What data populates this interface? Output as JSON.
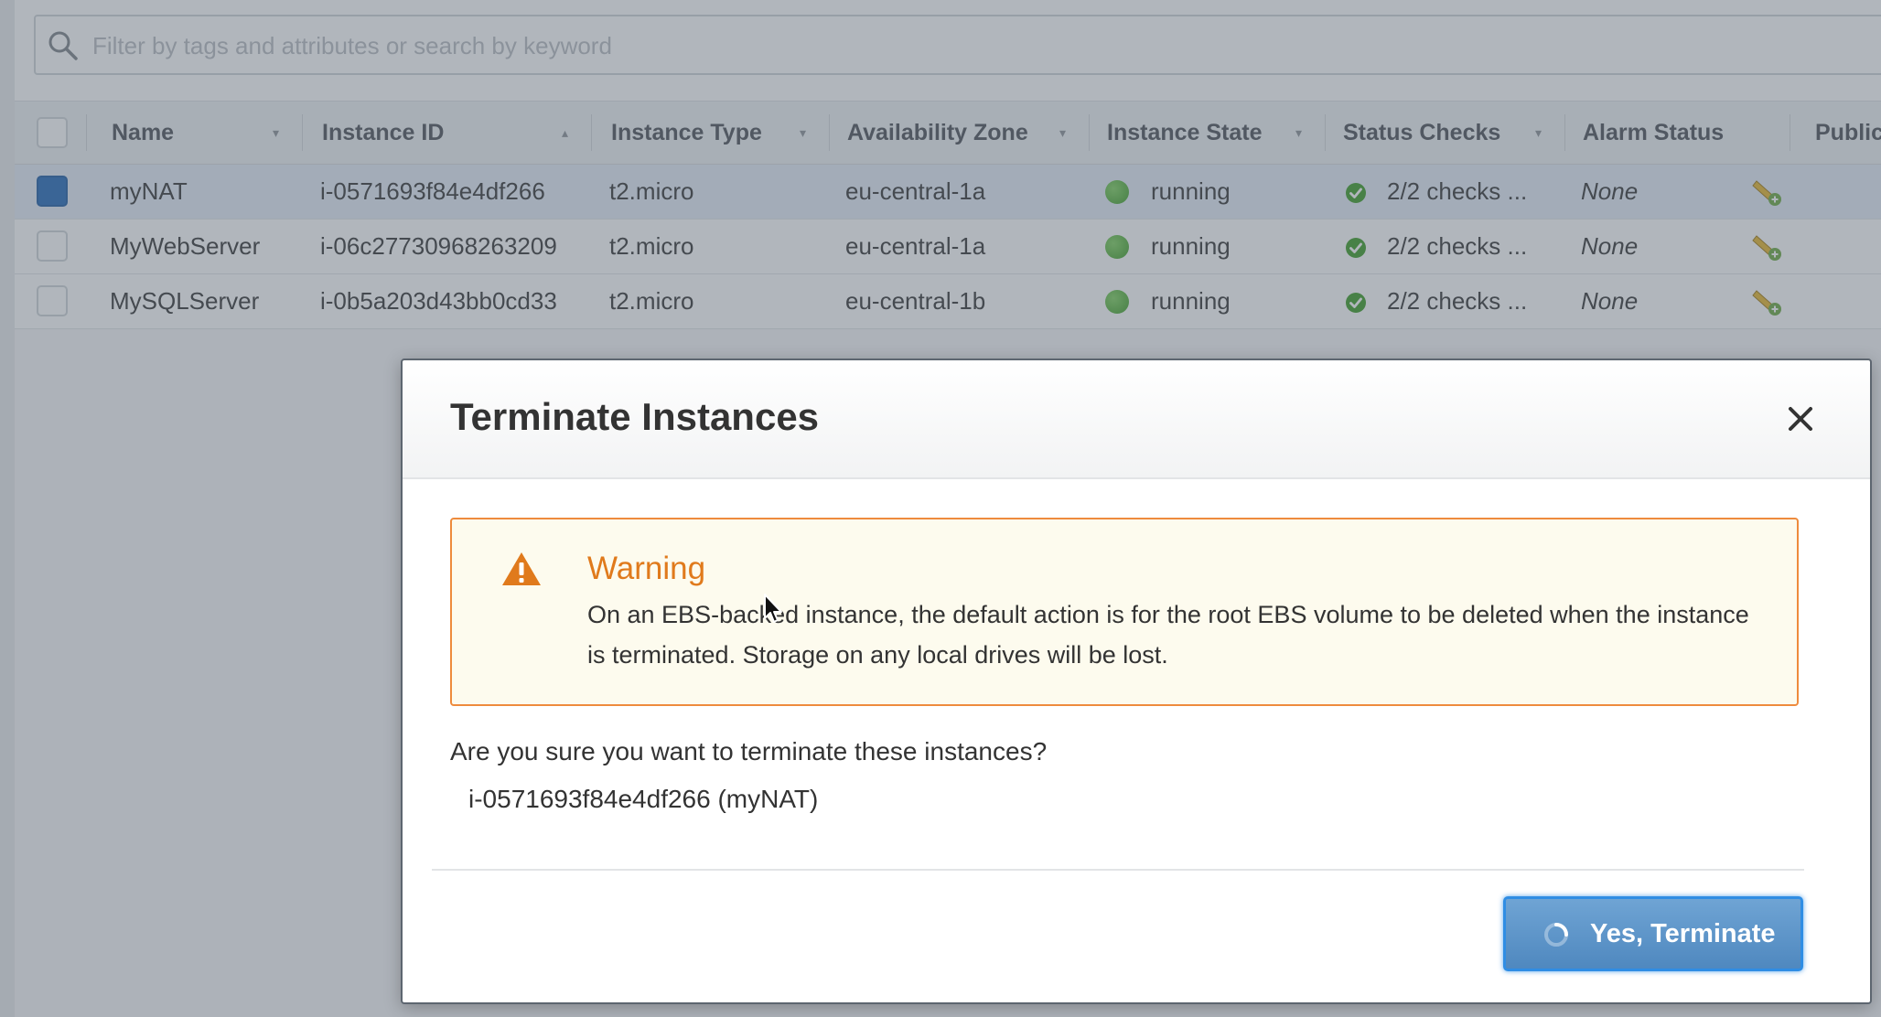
{
  "search": {
    "placeholder": "Filter by tags and attributes or search by keyword"
  },
  "table": {
    "columns": [
      {
        "label": "Name"
      },
      {
        "label": "Instance ID"
      },
      {
        "label": "Instance Type"
      },
      {
        "label": "Availability Zone"
      },
      {
        "label": "Instance State"
      },
      {
        "label": "Status Checks"
      },
      {
        "label": "Alarm Status"
      },
      {
        "label": "Public"
      }
    ],
    "rows": [
      {
        "selected": true,
        "name": "myNAT",
        "instance_id": "i-0571693f84e4df266",
        "instance_type": "t2.micro",
        "availability_zone": "eu-central-1a",
        "instance_state": "running",
        "status_checks": "2/2 checks ...",
        "alarm_status": "None"
      },
      {
        "selected": false,
        "name": "MyWebServer",
        "instance_id": "i-06c27730968263209",
        "instance_type": "t2.micro",
        "availability_zone": "eu-central-1a",
        "instance_state": "running",
        "status_checks": "2/2 checks ...",
        "alarm_status": "None"
      },
      {
        "selected": false,
        "name": "MySQLServer",
        "instance_id": "i-0b5a203d43bb0cd33",
        "instance_type": "t2.micro",
        "availability_zone": "eu-central-1b",
        "instance_state": "running",
        "status_checks": "2/2 checks ...",
        "alarm_status": "None"
      }
    ]
  },
  "modal": {
    "title": "Terminate Instances",
    "warning": {
      "title": "Warning",
      "text": "On an EBS-backed instance, the default action is for the root EBS volume to be deleted when the instance is terminated. Storage on any local drives will be lost."
    },
    "question": "Are you sure you want to terminate these instances?",
    "instances": [
      "i-0571693f84e4df266 (myNAT)"
    ],
    "confirm_button": "Yes, Terminate"
  },
  "colors": {
    "accent_blue": "#2f8de4",
    "warning_orange": "#e07a1c",
    "running_green": "#3a9b22"
  },
  "icons": {
    "search": "search-icon",
    "close": "close-icon",
    "warning": "warning-icon",
    "status_ok": "check-circle-icon",
    "alarm": "alarm-bell-icon",
    "spinner": "spinner-icon"
  }
}
